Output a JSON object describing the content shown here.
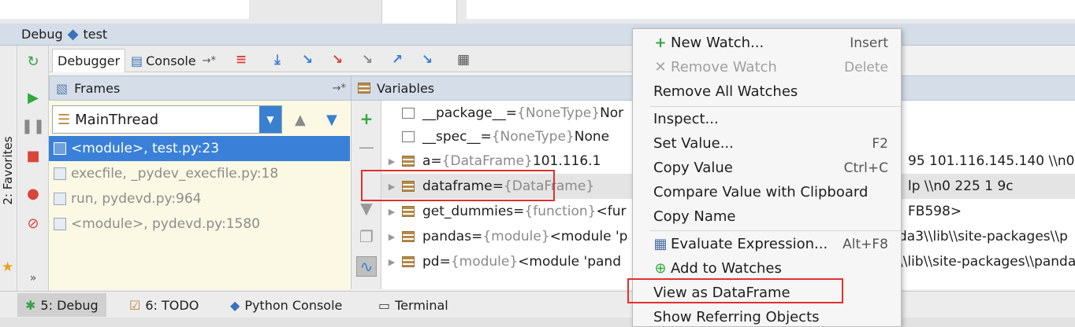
{
  "window": {
    "debug_label": "Debug",
    "config_name": "test"
  },
  "sidebar": {
    "favorites_label": "2: Favorites",
    "more_label": "»"
  },
  "tabs": {
    "debugger": "Debugger",
    "console": "Console",
    "console_pin": "→*"
  },
  "frames": {
    "header": "Frames",
    "pin": "→*",
    "thread": "MainThread",
    "items": [
      "<module>, test.py:23",
      "execfile, _pydev_execfile.py:18",
      "run, pydevd.py:964",
      "<module>, pydevd.py:1580"
    ]
  },
  "variables": {
    "header": "Variables",
    "rows": [
      {
        "name": "__package__",
        "eq": " = ",
        "type": "{NoneType}",
        "value": " Nor",
        "tail": ""
      },
      {
        "name": "__spec__",
        "eq": " = ",
        "type": "{NoneType}",
        "value": " None",
        "tail": ""
      },
      {
        "name": "a",
        "eq": " = ",
        "type": "{DataFrame}",
        "value": "       101.116.1",
        "tail": "95  101.116.145.140  \\\\n0"
      },
      {
        "name": "dataframe",
        "eq": " = ",
        "type": "{DataFrame}",
        "value": "",
        "tail": "lp  \\\\n0       225   1  9c"
      },
      {
        "name": "get_dummies",
        "eq": " = ",
        "type": "{function}",
        "value": " <fur",
        "tail": "FB598>"
      },
      {
        "name": "pandas",
        "eq": " = ",
        "type": "{module}",
        "value": " <module 'p",
        "tail": "da3\\\\lib\\\\site-packages\\\\p"
      },
      {
        "name": "pd",
        "eq": " = ",
        "type": "{module}",
        "value": " <module 'pand",
        "tail": "\\\\lib\\\\site-packages\\\\panda"
      }
    ]
  },
  "context_menu": {
    "items": [
      {
        "label": "New Watch...",
        "shortcut": "Insert",
        "icon": "plus-watch-icon",
        "glyph": "+",
        "disabled": false
      },
      {
        "label": "Remove Watch",
        "shortcut": "Delete",
        "icon": "remove-watch-icon",
        "glyph": "✕",
        "disabled": true
      },
      {
        "label": "Remove All Watches",
        "shortcut": "",
        "icon": "",
        "glyph": "",
        "disabled": false
      },
      {
        "label": "Inspect...",
        "shortcut": "",
        "icon": "",
        "glyph": "",
        "disabled": false
      },
      {
        "label": "Set Value...",
        "shortcut": "F2",
        "icon": "",
        "glyph": "",
        "disabled": false
      },
      {
        "label": "Copy Value",
        "shortcut": "Ctrl+C",
        "icon": "",
        "glyph": "",
        "disabled": false
      },
      {
        "label": "Compare Value with Clipboard",
        "shortcut": "",
        "icon": "",
        "glyph": "",
        "disabled": false
      },
      {
        "label": "Copy Name",
        "shortcut": "",
        "icon": "",
        "glyph": "",
        "disabled": false
      },
      {
        "label": "Evaluate Expression...",
        "shortcut": "Alt+F8",
        "icon": "calculator-icon",
        "glyph": "▦",
        "disabled": false
      },
      {
        "label": "Add to Watches",
        "shortcut": "",
        "icon": "add-watches-icon",
        "glyph": "⊕",
        "disabled": false
      },
      {
        "label": "View as DataFrame",
        "shortcut": "",
        "icon": "",
        "glyph": "",
        "disabled": false
      },
      {
        "label": "Show Referring Objects",
        "shortcut": "",
        "icon": "",
        "glyph": "",
        "disabled": false
      }
    ]
  },
  "bottom_tabs": [
    {
      "label": "5: Debug",
      "icon": "bug-icon",
      "glyph": "✱"
    },
    {
      "label": "6: TODO",
      "icon": "todo-icon",
      "glyph": "☑"
    },
    {
      "label": "Python Console",
      "icon": "python-icon",
      "glyph": "◆"
    },
    {
      "label": "Terminal",
      "icon": "terminal-icon",
      "glyph": "▭"
    }
  ],
  "colors": {
    "selection": "#3a80d8",
    "panel_header": "#d5dde8",
    "frames_bg": "#fbf9e4",
    "annotation": "#e03030"
  }
}
